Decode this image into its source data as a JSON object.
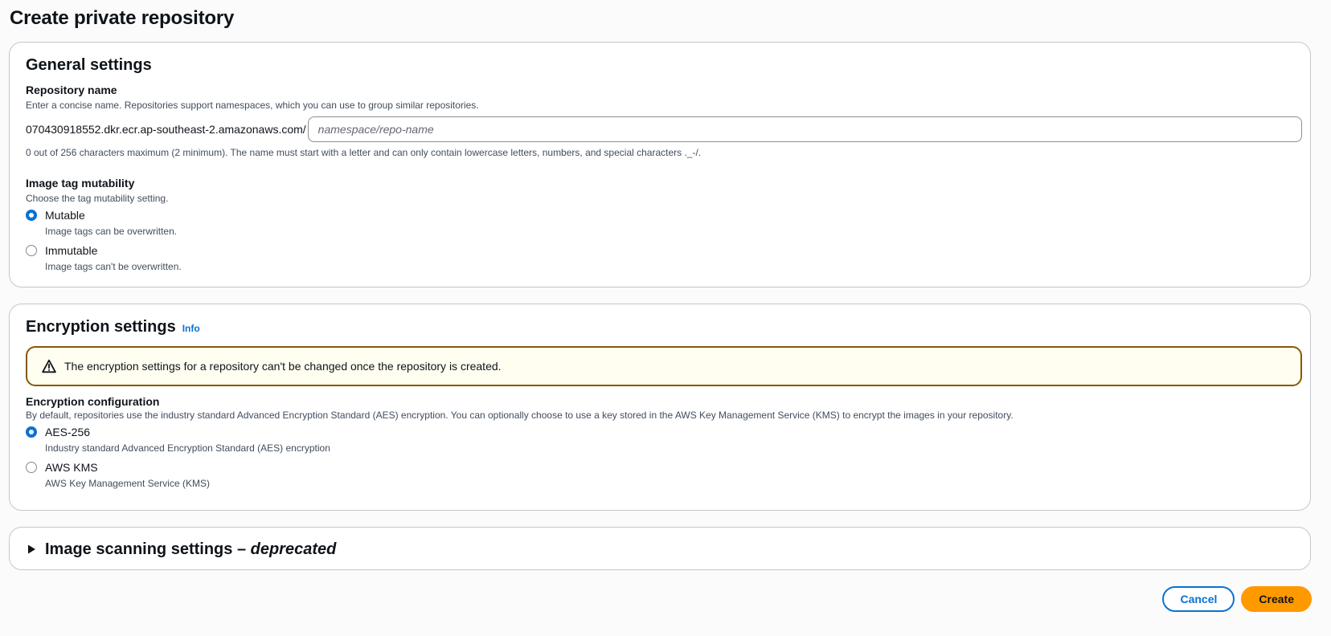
{
  "page": {
    "title": "Create private repository"
  },
  "general": {
    "heading": "General settings",
    "repo_name": {
      "label": "Repository name",
      "description": "Enter a concise name. Repositories support namespaces, which you can use to group similar repositories.",
      "prefix": "070430918552.dkr.ecr.ap-southeast-2.amazonaws.com/",
      "value": "",
      "placeholder": "namespace/repo-name",
      "constraint": "0 out of 256 characters maximum (2 minimum). The name must start with a letter and can only contain lowercase letters, numbers, and special characters ._-/."
    },
    "tag_mutability": {
      "label": "Image tag mutability",
      "description": "Choose the tag mutability setting.",
      "options": [
        {
          "label": "Mutable",
          "description": "Image tags can be overwritten.",
          "selected": true
        },
        {
          "label": "Immutable",
          "description": "Image tags can't be overwritten.",
          "selected": false
        }
      ]
    }
  },
  "encryption": {
    "heading": "Encryption settings",
    "info_label": "Info",
    "alert": "The encryption settings for a repository can't be changed once the repository is created.",
    "config": {
      "label": "Encryption configuration",
      "description": "By default, repositories use the industry standard Advanced Encryption Standard (AES) encryption. You can optionally choose to use a key stored in the AWS Key Management Service (KMS) to encrypt the images in your repository.",
      "options": [
        {
          "label": "AES-256",
          "description": "Industry standard Advanced Encryption Standard (AES) encryption",
          "selected": true
        },
        {
          "label": "AWS KMS",
          "description": "AWS Key Management Service (KMS)",
          "selected": false
        }
      ]
    }
  },
  "scanning": {
    "title_main": "Image scanning settings – ",
    "title_emphasis": "deprecated",
    "expanded": false
  },
  "actions": {
    "cancel_label": "Cancel",
    "create_label": "Create"
  },
  "colors": {
    "accent": "#0972d3",
    "primary_button": "#ff9900",
    "warning_border": "#855900",
    "warning_background": "#fffef0"
  }
}
